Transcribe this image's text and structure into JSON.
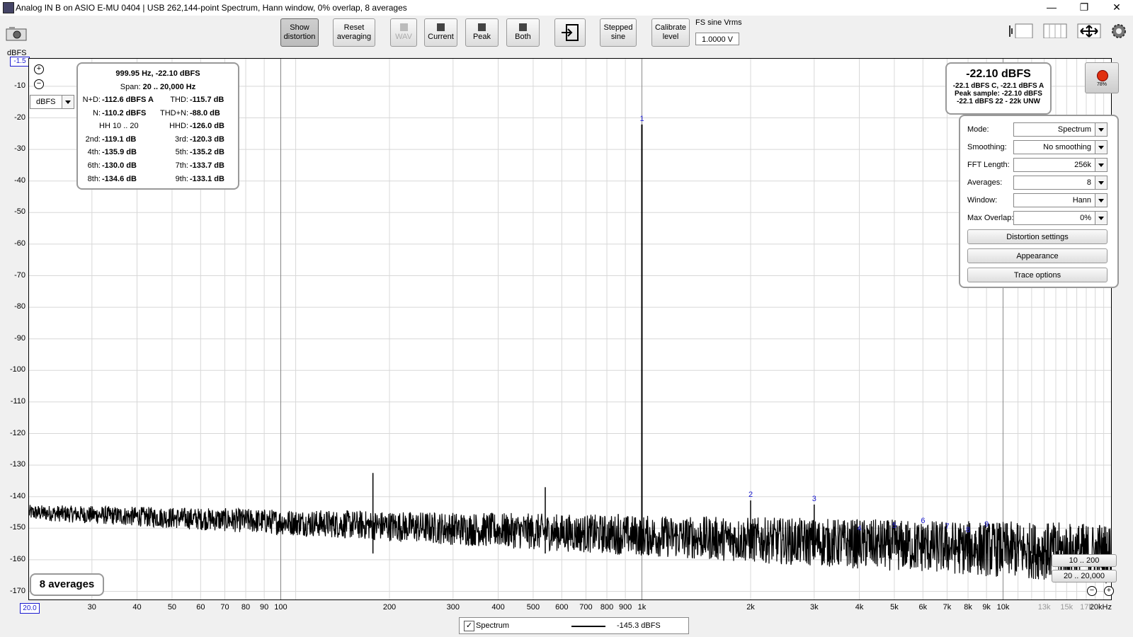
{
  "window": {
    "title": "Analog IN B on ASIO E-MU 0404 | USB 262,144-point Spectrum, Hann window, 0% overlap, 8 averages",
    "minimize": "—",
    "restore": "❐",
    "close": "✕"
  },
  "toolbar": {
    "show_distortion": [
      "Show",
      "distortion"
    ],
    "reset_averaging": [
      "Reset",
      "averaging"
    ],
    "wav": "WAV",
    "current": "Current",
    "peak": "Peak",
    "both": "Both",
    "stepped_sine": [
      "Stepped",
      "sine"
    ],
    "calibrate_level": [
      "Calibrate",
      "level"
    ],
    "fs_label": "FS sine Vrms",
    "fs_value": "1.0000 V"
  },
  "plot": {
    "y_unit": "dBFS",
    "y_top_value": "-1.5",
    "unit_select": "dBFS",
    "y_labels": [
      "-10",
      "-20",
      "-30",
      "-40",
      "-50",
      "-60",
      "-70",
      "-80",
      "-90",
      "-100",
      "-110",
      "-120",
      "-130",
      "-140",
      "-150",
      "-160",
      "-170"
    ],
    "x_start": "20.0",
    "x_labels": [
      "30",
      "40",
      "50",
      "60",
      "70",
      "80",
      "90",
      "100",
      "200",
      "300",
      "400",
      "500",
      "600",
      "700",
      "800",
      "900",
      "1k",
      "2k",
      "3k",
      "4k",
      "5k",
      "6k",
      "7k",
      "8k",
      "9k",
      "10k"
    ],
    "x_labels_grey": [
      "13k",
      "15k",
      "17k"
    ],
    "x_end": "20kHz",
    "harmonic_marks": [
      "1",
      "2",
      "3",
      "4",
      "5",
      "6",
      "7",
      "8",
      "9"
    ],
    "averages_badge": "8 averages"
  },
  "distortion_panel": {
    "header": "999.95 Hz, -22.10 dBFS",
    "span_label": "Span:",
    "span_value": "20 .. 20,000 Hz",
    "rows": [
      {
        "l1": "N+D:",
        "v1": "-112.6 dBFS A",
        "l2": "THD:",
        "v2": "-115.7 dB"
      },
      {
        "l1": "N:",
        "v1": "-110.2 dBFS",
        "l2": "THD+N:",
        "v2": "-88.0 dB"
      },
      {
        "l1": "HH 10 .. 20",
        "v1": "",
        "l2": "HHD:",
        "v2": "-126.0 dB"
      },
      {
        "l1": "2nd:",
        "v1": "-119.1 dB",
        "l2": "3rd:",
        "v2": "-120.3 dB"
      },
      {
        "l1": "4th:",
        "v1": "-135.9 dB",
        "l2": "5th:",
        "v2": "-135.2 dB"
      },
      {
        "l1": "6th:",
        "v1": "-130.0 dB",
        "l2": "7th:",
        "v2": "-133.7 dB"
      },
      {
        "l1": "8th:",
        "v1": "-134.6 dB",
        "l2": "9th:",
        "v2": "-133.1 dB"
      }
    ]
  },
  "level_panel": {
    "main": "-22.10 dBFS",
    "line1": "-22.1 dBFS C, -22.1 dBFS A",
    "line2": "Peak sample: -22.10 dBFS",
    "line3": "-22.1 dBFS 22 - 22k UNW"
  },
  "record_indicator": "78%",
  "controls": {
    "mode": {
      "label": "Mode:",
      "value": "Spectrum"
    },
    "smoothing": {
      "label": "Smoothing:",
      "value": "No  smoothing"
    },
    "fft_length": {
      "label": "FFT Length:",
      "value": "256k"
    },
    "averages": {
      "label": "Averages:",
      "value": "8"
    },
    "window": {
      "label": "Window:",
      "value": "Hann"
    },
    "max_overlap": {
      "label": "Max Overlap:",
      "value": "0%"
    },
    "distortion_settings": "Distortion settings",
    "appearance": "Appearance",
    "trace_options": "Trace options"
  },
  "range_buttons": {
    "a": "10 .. 200",
    "b": "20 .. 20,000"
  },
  "legend": {
    "checkbox": "✓",
    "name": "Spectrum",
    "value": "-145.3 dBFS"
  },
  "colors": {
    "trace": "#000000",
    "harmonic_label": "#1a1ad0",
    "grid": "#d8d8d8",
    "grid_major": "#888888",
    "record": "#e03010"
  }
}
